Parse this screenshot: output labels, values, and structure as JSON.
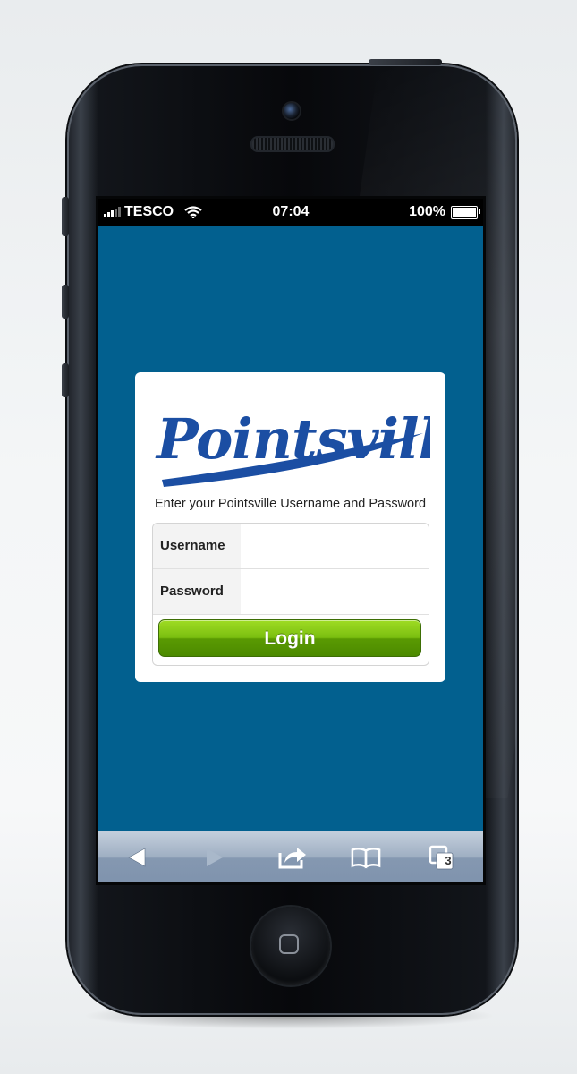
{
  "status_bar": {
    "carrier": "TESCO",
    "time": "07:04",
    "battery": "100%"
  },
  "brand": {
    "logo_text": "Pointsville",
    "logo_color": "#1b4ea3"
  },
  "login": {
    "prompt": "Enter your Pointsville Username and Password",
    "username_label": "Username",
    "username_value": "",
    "password_label": "Password",
    "password_value": "",
    "button_label": "Login"
  },
  "toolbar": {
    "tabs_count": "3",
    "icons": [
      "back-icon",
      "forward-icon",
      "share-icon",
      "bookmarks-icon",
      "tabs-icon"
    ]
  },
  "colors": {
    "background": "#02608f",
    "button": "#7bbf10"
  }
}
